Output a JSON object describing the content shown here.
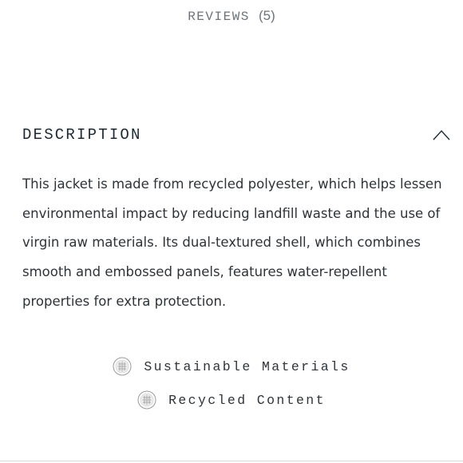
{
  "reviews": {
    "label": "REVIEWS",
    "count": "(5)"
  },
  "description": {
    "title": "DESCRIPTION",
    "toggle_icon": "chevron-up-icon",
    "body": "This jacket is made from recycled polyester, which helps lessen environmental impact by reducing landfill waste and the use of virgin raw materials. Its dual-textured shell, which combines smooth and embossed panels, features water-repellent properties for extra protection."
  },
  "features": [
    {
      "label": "Sustainable Materials",
      "icon": "sustainability-badge-icon"
    },
    {
      "label": "Recycled Content",
      "icon": "recycled-badge-icon"
    }
  ]
}
